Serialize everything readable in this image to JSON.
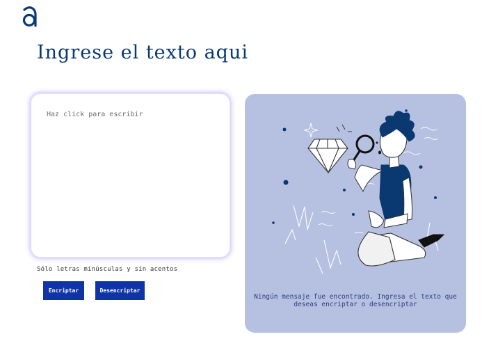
{
  "brand": {
    "logo_icon": "alura-logo-icon",
    "color": "#0a3871"
  },
  "header": {
    "title": "Ingrese el texto aqui"
  },
  "input": {
    "placeholder": "Haz click para escribir",
    "value": ""
  },
  "hint": {
    "text": "Sólo letras minúsculas y sin acentos"
  },
  "buttons": {
    "encrypt_label": "Encriptar",
    "decrypt_label": "Desencriptar",
    "color": "#1034a6"
  },
  "output": {
    "panel_color": "#b6c1e2",
    "illustration_icon": "person-with-magnifying-glass-and-diamond-illustration",
    "empty_message": "Ningún mensaje fue encontrado. Ingresa el texto que deseas encriptar o desencriptar"
  }
}
